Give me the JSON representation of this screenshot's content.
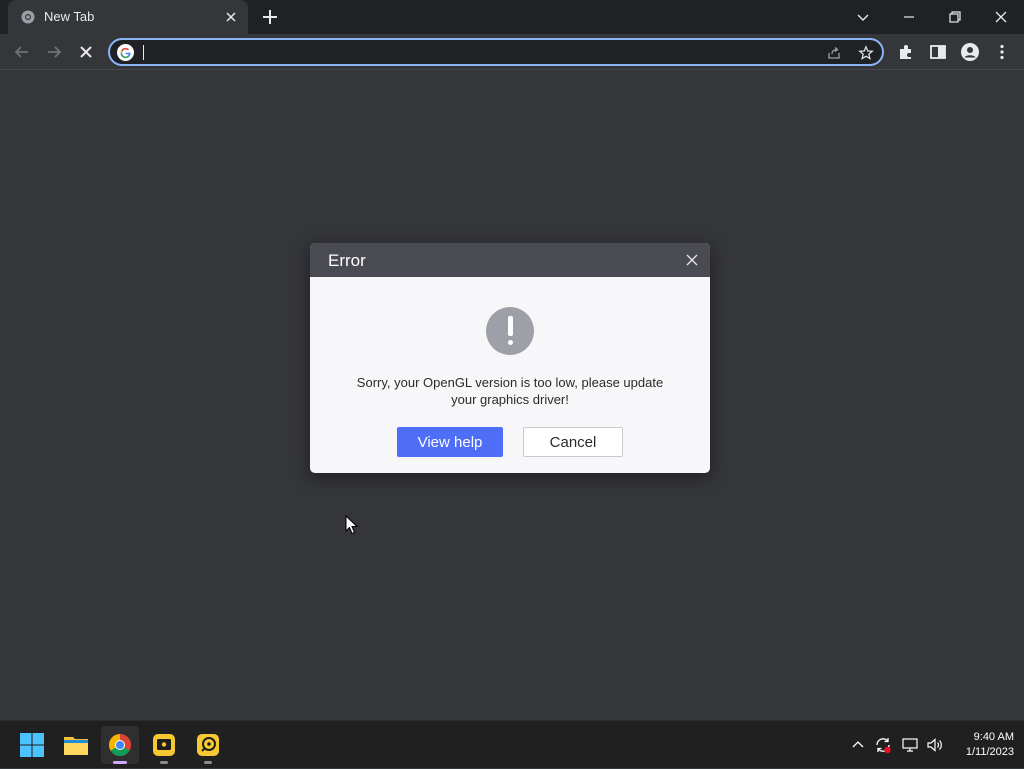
{
  "colors": {
    "frame": "#202124",
    "page_bg": "#35363a",
    "omnibox_focus": "#8ab4f8",
    "dialog_header": "#4a4b52",
    "primary_button": "#4f6ef7",
    "taskbar": "#202020"
  },
  "browser": {
    "tab": {
      "title": "New Tab",
      "favicon": "chrome-newtab-icon"
    },
    "omnibox": {
      "value": "",
      "placeholder": ""
    },
    "window_controls": [
      "tab-search-icon",
      "minimize-icon",
      "restore-icon",
      "close-icon"
    ],
    "toolbar_icons": [
      "back-arrow-icon",
      "forward-arrow-icon",
      "stop-loading-icon",
      "share-icon",
      "bookmark-star-icon",
      "extensions-icon",
      "side-panel-icon",
      "profile-icon",
      "more-menu-icon"
    ]
  },
  "dialog": {
    "title": "Error",
    "icon": "exclamation-icon",
    "message_line1": "Sorry, your OpenGL version is too low, please update",
    "message_line2": "your graphics driver!",
    "primary_button": "View help",
    "secondary_button": "Cancel"
  },
  "taskbar": {
    "apps": [
      "windows-start-icon",
      "file-explorer-icon",
      "chrome-icon",
      "yellow-app-icon",
      "remote-app-icon"
    ],
    "tray_icons": [
      "show-hidden-icons-chevron",
      "sync-icon",
      "network-icon",
      "volume-icon"
    ],
    "time": "9:40 AM",
    "date": "1/11/2023"
  }
}
